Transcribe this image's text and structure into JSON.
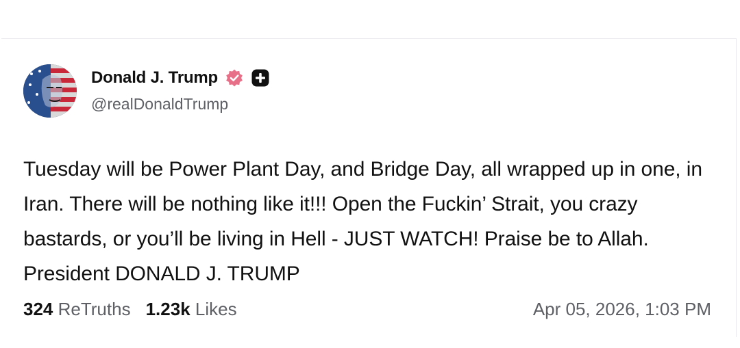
{
  "post": {
    "author": {
      "display_name": "Donald J. Trump",
      "handle": "@realDonaldTrump",
      "avatar": "avatar-icon",
      "badges": [
        "verified-icon",
        "plus-badge-icon"
      ]
    },
    "text": "Tuesday will be Power Plant Day, and Bridge Day, all wrapped up in one, in Iran. There will be nothing like it!!! Open the Fuckin’ Strait, you crazy bastards, or you’ll be living in Hell - JUST WATCH! Praise be to Allah. President DONALD J. TRUMP",
    "stats": {
      "retruths_count": "324",
      "retruths_label": "ReTruths",
      "likes_count": "1.23k",
      "likes_label": "Likes"
    },
    "timestamp": "Apr 05, 2026, 1:03 PM"
  },
  "colors": {
    "verified_badge": "#e86f88",
    "plus_badge": "#111111",
    "muted_text": "#5e6066"
  }
}
